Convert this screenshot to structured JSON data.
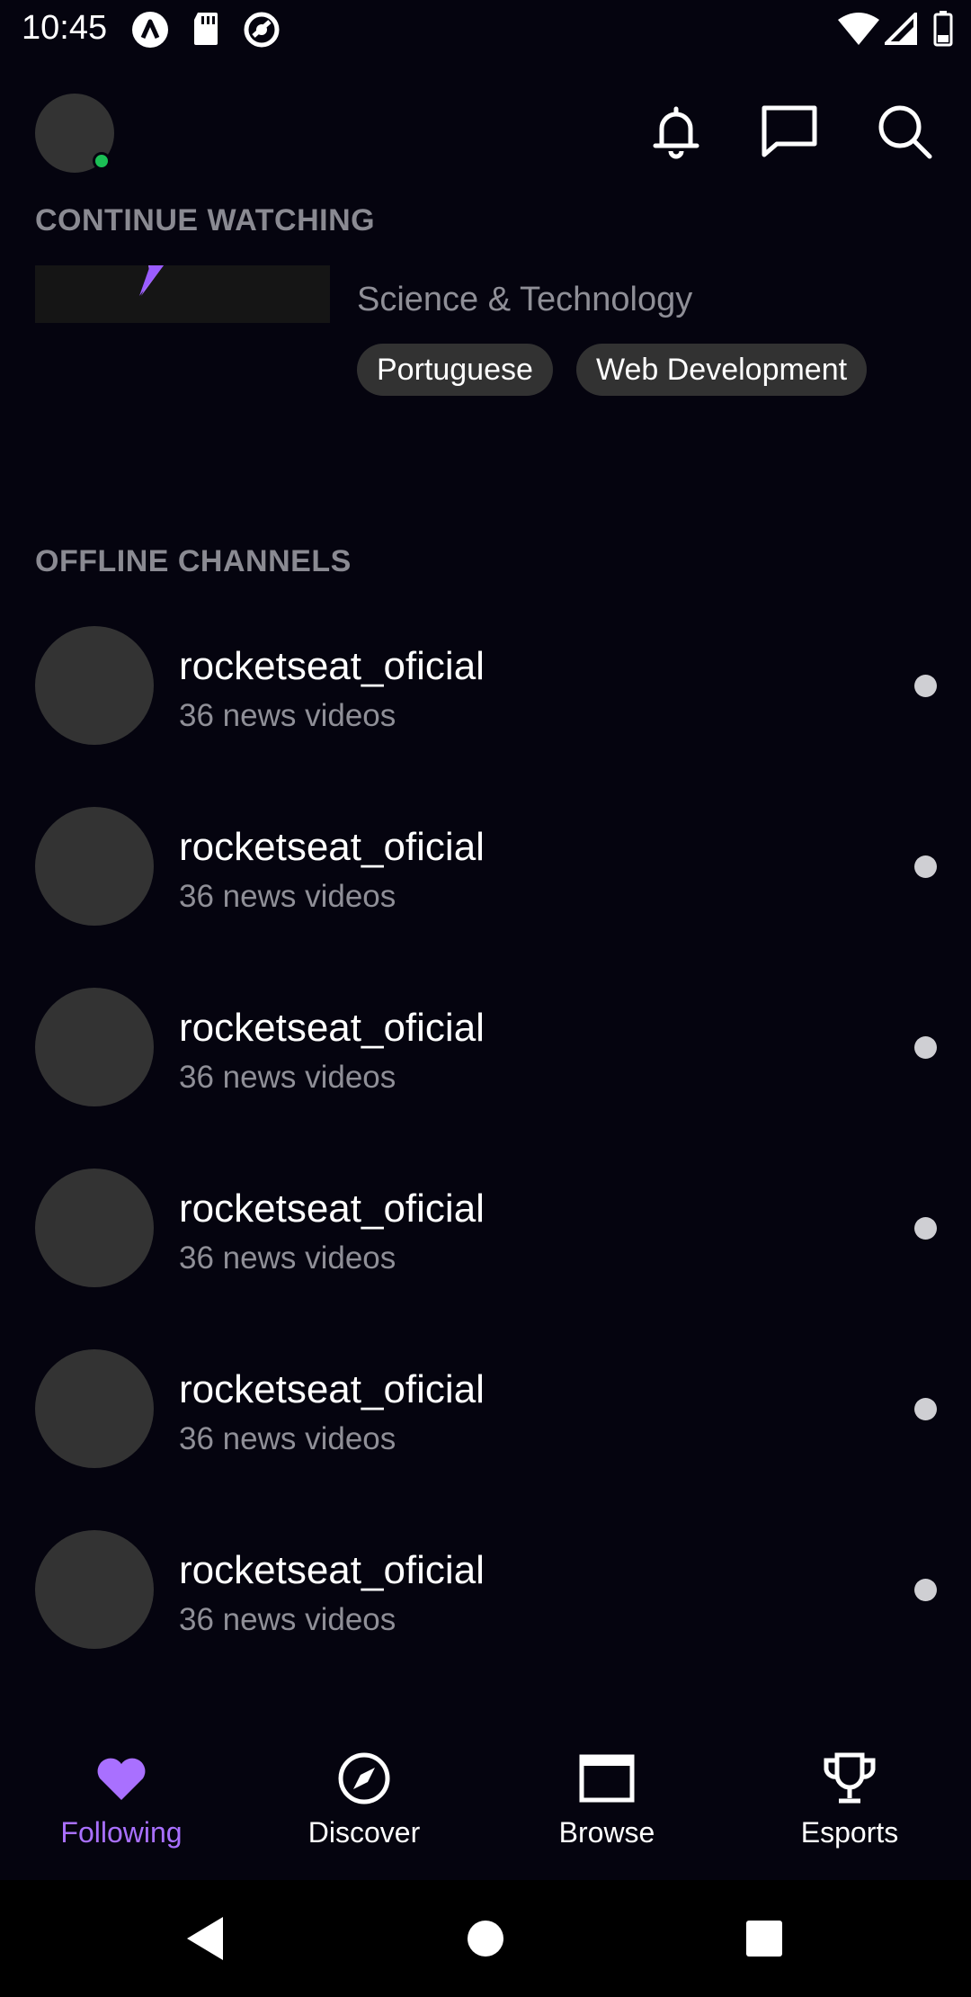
{
  "status_bar": {
    "time": "10:45",
    "left_icons": [
      "a-icon",
      "sd-card-icon",
      "sync-circle-icon"
    ],
    "right_icons": [
      "wifi-icon",
      "signal-icon",
      "battery-icon"
    ]
  },
  "header": {
    "avatar_status_color": "#1bbf55",
    "icons": [
      "bell-icon",
      "chat-icon",
      "search-icon"
    ]
  },
  "continue_watching": {
    "section_title": "CONTINUE WATCHING",
    "category": "Science & Technology",
    "tags": [
      "Portuguese",
      "Web Development"
    ],
    "accent_color": "#a970ff"
  },
  "offline_channels": {
    "section_title": "OFFLINE CHANNELS",
    "channels": [
      {
        "name": "rocketseat_oficial",
        "subtitle": "36 news videos"
      },
      {
        "name": "rocketseat_oficial",
        "subtitle": "36 news videos"
      },
      {
        "name": "rocketseat_oficial",
        "subtitle": "36 news videos"
      },
      {
        "name": "rocketseat_oficial",
        "subtitle": "36 news videos"
      },
      {
        "name": "rocketseat_oficial",
        "subtitle": "36 news videos"
      },
      {
        "name": "rocketseat_oficial",
        "subtitle": "36 news videos"
      }
    ]
  },
  "bottom_nav": {
    "items": [
      {
        "label": "Following",
        "icon": "heart-icon",
        "active": true
      },
      {
        "label": "Discover",
        "icon": "compass-icon",
        "active": false
      },
      {
        "label": "Browse",
        "icon": "browse-window-icon",
        "active": false
      },
      {
        "label": "Esports",
        "icon": "trophy-icon",
        "active": false
      }
    ],
    "active_color": "#a970ff"
  },
  "system_nav": {
    "icons": [
      "back-triangle-icon",
      "home-circle-icon",
      "recents-square-icon"
    ]
  }
}
